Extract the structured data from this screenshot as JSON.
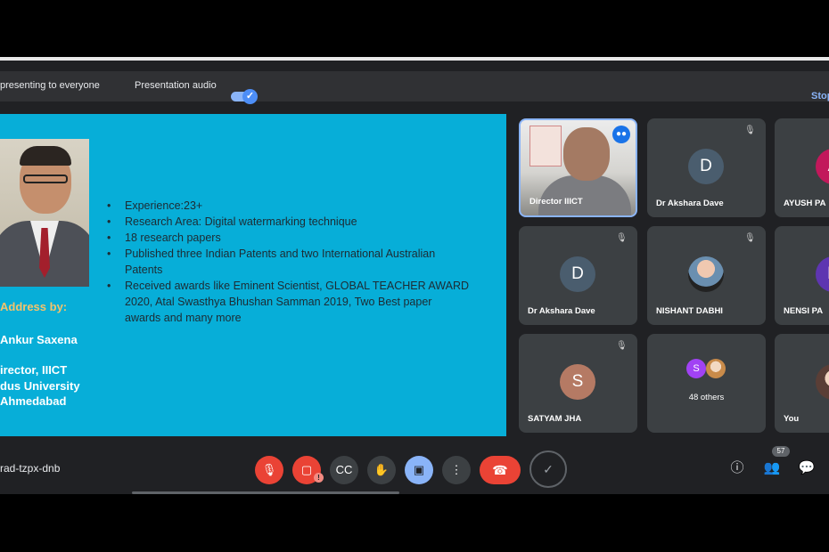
{
  "presentation_bar": {
    "presenting_text": "presenting to everyone",
    "audio_label": "Presentation audio",
    "audio_toggle": "on",
    "stop_label": "Stop"
  },
  "slide": {
    "bullets": [
      "Experience:23+",
      "Research Area: Digital watermarking technique",
      "18 research papers",
      "Published three Indian Patents and two International Australian Patents",
      "Received awards like Eminent Scientist, GLOBAL TEACHER AWARD 2020, Atal Swasthya Bhushan Samman 2019, Two Best paper awards and many more"
    ],
    "address_label": "Address by:",
    "speaker_name": "Ankur Saxena",
    "speaker_title": "irector, IIICT",
    "speaker_org": "dus University",
    "speaker_city": "Ahmedabad"
  },
  "participants": [
    {
      "name": "Director IIICT",
      "type": "video",
      "speaking": true
    },
    {
      "name": "Dr Akshara Dave",
      "initial": "D",
      "color": "#4a5d6e",
      "muted": true
    },
    {
      "name": "AYUSH PA",
      "initial": "A",
      "color": "#c2185b"
    },
    {
      "name": "Dr Akshara Dave",
      "initial": "D",
      "color": "#4a5d6e",
      "muted": true
    },
    {
      "name": "NISHANT DABHI",
      "type": "photo",
      "muted": true
    },
    {
      "name": "NENSI PA",
      "initial": "N",
      "color": "#5e35b1"
    },
    {
      "name": "SATYAM JHA",
      "initial": "S",
      "color": "#b57a64",
      "muted": true
    },
    {
      "name": "48 others",
      "initial": "S",
      "color": "#a142f4"
    },
    {
      "name": "You",
      "type": "photo"
    }
  ],
  "bottom_bar": {
    "meeting_code": "rad-tzpx-dnb",
    "people_count": "57"
  },
  "icons": {
    "mic": "mic-off-icon",
    "camera": "camera-off-icon",
    "captions": "captions-icon",
    "hand": "raise-hand-icon",
    "present": "present-icon",
    "more": "more-vert-icon",
    "end": "end-call-icon",
    "info": "info-icon",
    "people": "people-icon",
    "chat": "chat-icon"
  },
  "colors": {
    "slide_bg": "#07aed8",
    "accent_red": "#ea4335",
    "accent_blue": "#8ab4f8",
    "address_color": "#f5c36b"
  }
}
